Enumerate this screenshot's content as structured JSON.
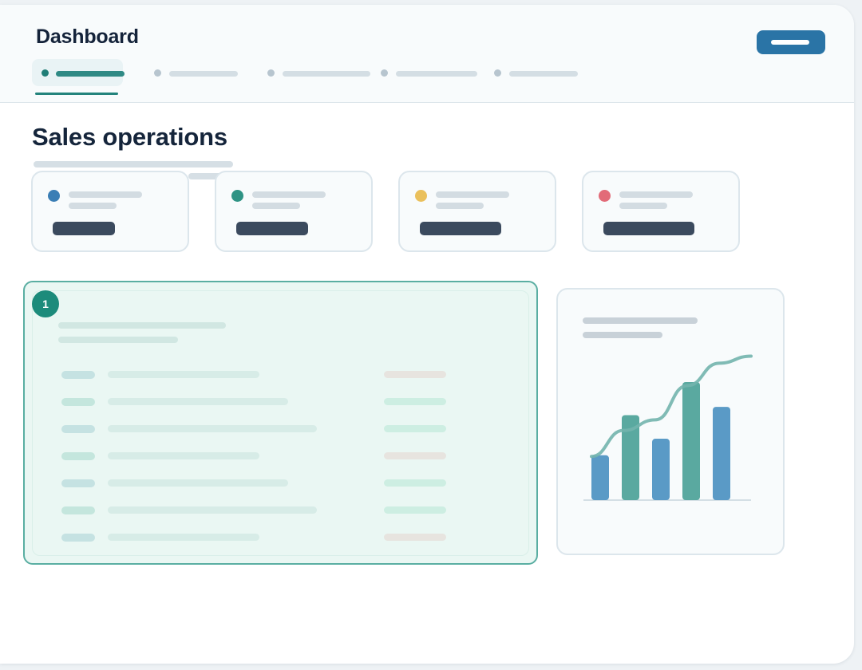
{
  "app": {
    "title": "Dashboard"
  },
  "page": {
    "title": "Sales operations"
  },
  "tabs": [
    {
      "state": "active"
    },
    {
      "state": "inactive"
    },
    {
      "state": "inactive"
    },
    {
      "state": "inactive"
    },
    {
      "state": "inactive"
    }
  ],
  "kpis": [
    {
      "status_color": "#3a7eb5"
    },
    {
      "status_color": "#2f9384"
    },
    {
      "status_color": "#eac05c"
    },
    {
      "status_color": "#e26b78"
    }
  ],
  "table": {
    "badge": "1",
    "rows": [
      {
        "tag_color": "#c5e2e2",
        "status_color": "#e7e4df"
      },
      {
        "tag_color": "#c4e6dd",
        "status_color": "#cdeee2"
      },
      {
        "tag_color": "#c5e2e2",
        "status_color": "#cdeee2"
      },
      {
        "tag_color": "#c4e6dd",
        "status_color": "#e7e4df"
      },
      {
        "tag_color": "#c5e2e2",
        "status_color": "#cdeee2"
      },
      {
        "tag_color": "#c4e6dd",
        "status_color": "#cdeee2"
      },
      {
        "tag_color": "#c5e2e2",
        "status_color": "#e7e4df"
      }
    ]
  },
  "colors": {
    "accent": "#23837c",
    "primary_button": "#2a74a6",
    "bar_blue": "#5a9ac6",
    "bar_teal": "#5aa9a0",
    "trend_line": "#72b4ad"
  },
  "chart_data": {
    "type": "bar",
    "title": "",
    "xlabel": "",
    "ylabel": "",
    "categories": [
      "",
      "",
      "",
      "",
      ""
    ],
    "values": [
      38,
      72,
      52,
      100,
      79
    ],
    "bar_colors": [
      "#5a9ac6",
      "#5aa9a0",
      "#5a9ac6",
      "#5aa9a0",
      "#5a9ac6"
    ],
    "ylim": [
      0,
      100
    ],
    "trend_line": [
      37,
      59,
      68,
      97,
      116,
      122
    ],
    "grid": false,
    "legend": "none"
  }
}
